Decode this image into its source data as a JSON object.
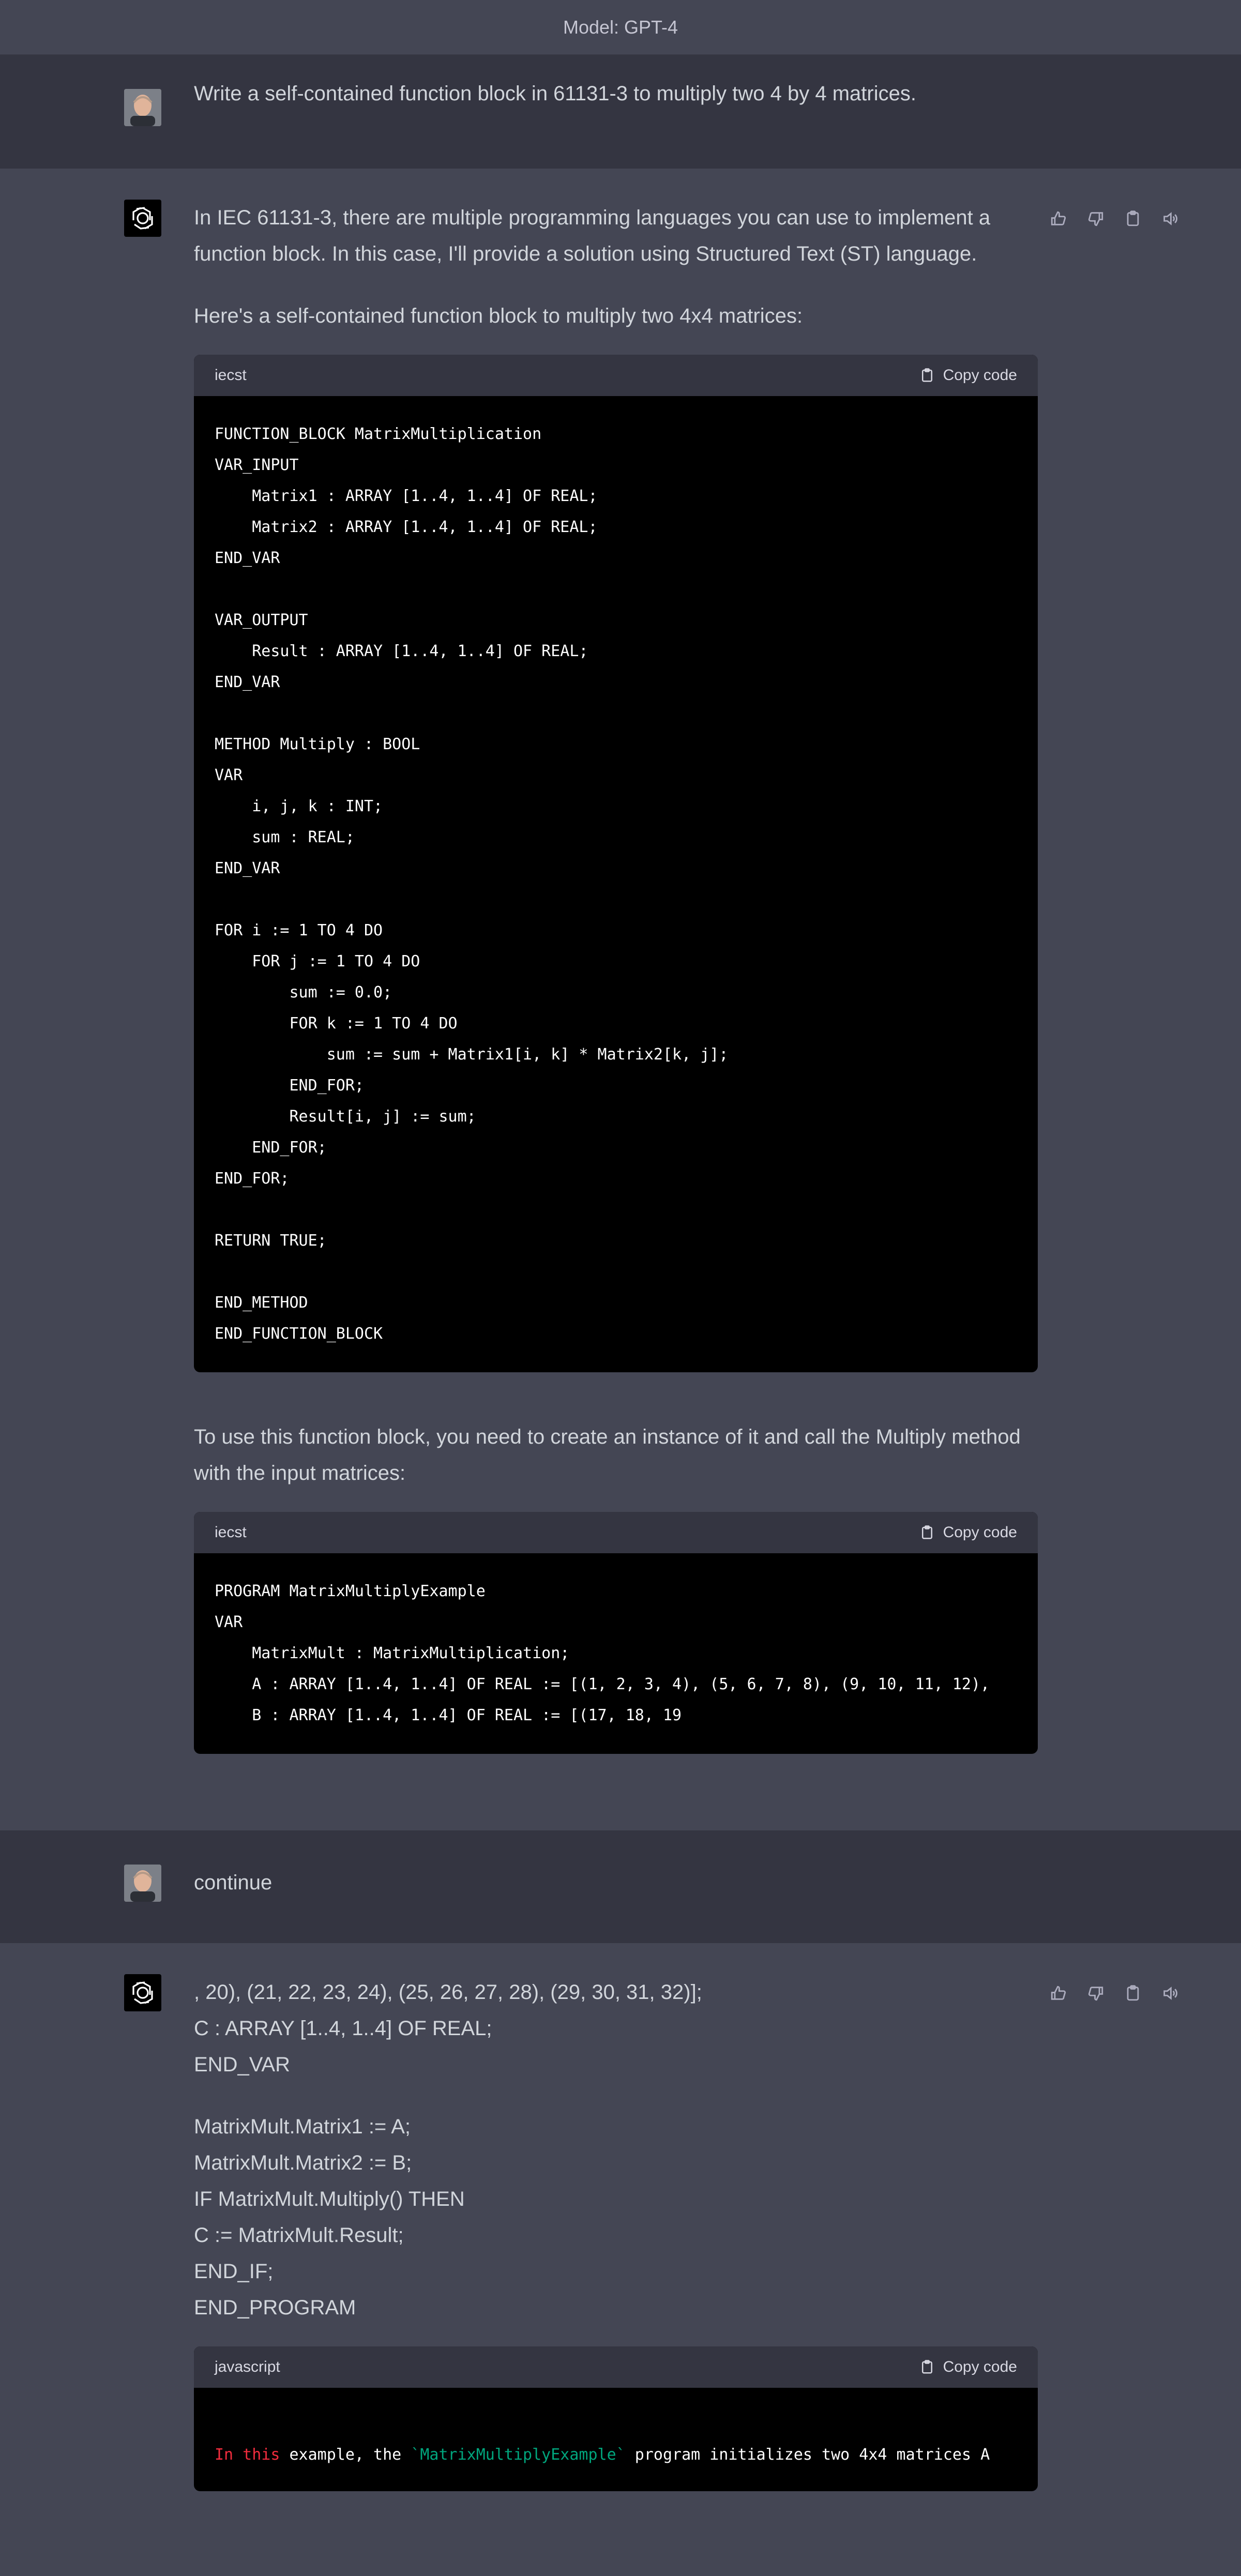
{
  "header": {
    "model_label": "Model: GPT-4"
  },
  "conversation": {
    "user_prompt_1": "Write a self-contained function block in 61131-3 to multiply two 4 by 4 matrices.",
    "assistant_1": {
      "intro_p1": "In IEC 61131-3, there are multiple programming languages you can use to implement a function block. In this case, I'll provide a solution using Structured Text (ST) language.",
      "intro_p2": "Here's a self-contained function block to multiply two 4x4 matrices:",
      "code1": {
        "language": "iecst",
        "copy_label": "Copy code",
        "text": "FUNCTION_BLOCK MatrixMultiplication\nVAR_INPUT\n    Matrix1 : ARRAY [1..4, 1..4] OF REAL;\n    Matrix2 : ARRAY [1..4, 1..4] OF REAL;\nEND_VAR\n\nVAR_OUTPUT\n    Result : ARRAY [1..4, 1..4] OF REAL;\nEND_VAR\n\nMETHOD Multiply : BOOL\nVAR\n    i, j, k : INT;\n    sum : REAL;\nEND_VAR\n\nFOR i := 1 TO 4 DO\n    FOR j := 1 TO 4 DO\n        sum := 0.0;\n        FOR k := 1 TO 4 DO\n            sum := sum + Matrix1[i, k] * Matrix2[k, j];\n        END_FOR;\n        Result[i, j] := sum;\n    END_FOR;\nEND_FOR;\n\nRETURN TRUE;\n\nEND_METHOD\nEND_FUNCTION_BLOCK"
      },
      "usage_p": "To use this function block, you need to create an instance of it and call the Multiply method with the input matrices:",
      "code2": {
        "language": "iecst",
        "copy_label": "Copy code",
        "text": "PROGRAM MatrixMultiplyExample\nVAR\n    MatrixMult : MatrixMultiplication;\n    A : ARRAY [1..4, 1..4] OF REAL := [(1, 2, 3, 4), (5, 6, 7, 8), (9, 10, 11, 12),\n    B : ARRAY [1..4, 1..4] OF REAL := [(17, 18, 19"
      }
    },
    "user_prompt_2": "continue",
    "assistant_2": {
      "lines_a": [
        ", 20), (21, 22, 23, 24), (25, 26, 27, 28), (29, 30, 31, 32)];",
        "C : ARRAY [1..4, 1..4] OF REAL;",
        "END_VAR"
      ],
      "lines_b": [
        "MatrixMult.Matrix1 := A;",
        "MatrixMult.Matrix2 := B;",
        "IF MatrixMult.Multiply() THEN",
        "C := MatrixMult.Result;",
        "END_IF;",
        "END_PROGRAM"
      ],
      "code3": {
        "language": "javascript",
        "copy_label": "Copy code",
        "seg_kw": "In this",
        "seg_1": " example, the ",
        "seg_str": "`MatrixMultiplyExample`",
        "seg_2": " program initializes two 4x4 matrices A"
      }
    }
  },
  "icons": [
    "thumbs-up-icon",
    "thumbs-down-icon",
    "clipboard-icon",
    "speaker-icon",
    "openai-logo-icon",
    "user-avatar"
  ]
}
